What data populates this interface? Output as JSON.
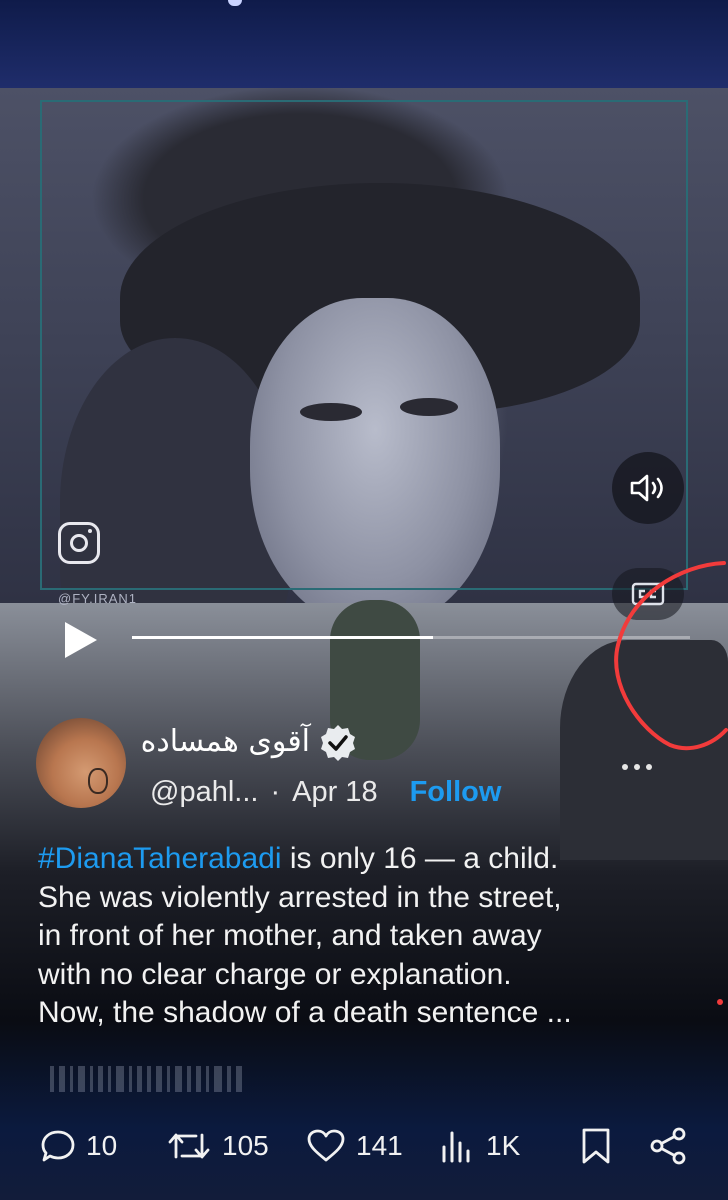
{
  "video": {
    "watermark_text": "@FY.IRAN1",
    "progress": 0.54
  },
  "tweet": {
    "display_name": "آقوی همساده",
    "handle": "@pahl...",
    "separator": "·",
    "date": "Apr 18",
    "follow_label": "Follow",
    "hashtag": "#DianaTaherabadi",
    "text_after_hashtag": " is only 16 — a child.\nShe was violently arrested in the street,\nin front of her mother, and taken away\nwith no clear charge or explanation.\nNow, the shadow of a death sentence ..."
  },
  "actions": {
    "replies": "10",
    "reposts": "105",
    "likes": "141",
    "views": "1K"
  },
  "icons": {
    "sound": "speaker-icon",
    "captions": "captions-icon",
    "play": "play-icon",
    "reply": "reply-icon",
    "repost": "repost-icon",
    "like": "heart-icon",
    "views": "views-icon",
    "bookmark": "bookmark-icon",
    "share": "share-icon",
    "instagram": "instagram-icon",
    "verified": "verified-badge-icon",
    "more": "more-icon"
  },
  "colors": {
    "accent": "#1d9bf0",
    "annotation": "#f23b3b"
  }
}
